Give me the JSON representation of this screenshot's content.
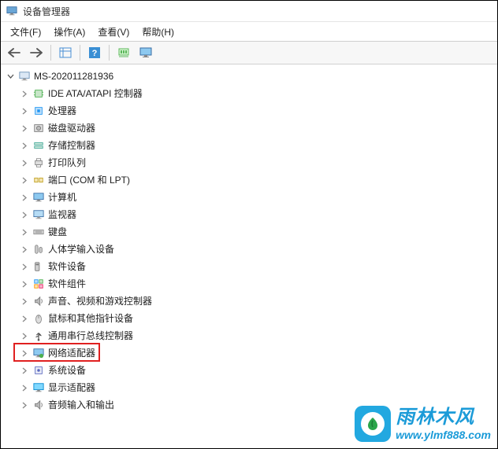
{
  "window": {
    "title": "设备管理器"
  },
  "menu": {
    "file": "文件(F)",
    "action": "操作(A)",
    "view": "查看(V)",
    "help": "帮助(H)"
  },
  "tree": {
    "root": "MS-202011281936",
    "items": [
      {
        "label": "IDE ATA/ATAPI 控制器",
        "icon": "chip",
        "highlighted": false
      },
      {
        "label": "处理器",
        "icon": "cpu",
        "highlighted": false
      },
      {
        "label": "磁盘驱动器",
        "icon": "disk",
        "highlighted": false
      },
      {
        "label": "存储控制器",
        "icon": "storage",
        "highlighted": false
      },
      {
        "label": "打印队列",
        "icon": "printer",
        "highlighted": false
      },
      {
        "label": "端口 (COM 和 LPT)",
        "icon": "port",
        "highlighted": false
      },
      {
        "label": "计算机",
        "icon": "computer",
        "highlighted": false
      },
      {
        "label": "监视器",
        "icon": "monitor",
        "highlighted": false
      },
      {
        "label": "键盘",
        "icon": "keyboard",
        "highlighted": false
      },
      {
        "label": "人体学输入设备",
        "icon": "hid",
        "highlighted": false
      },
      {
        "label": "软件设备",
        "icon": "software",
        "highlighted": false
      },
      {
        "label": "软件组件",
        "icon": "component",
        "highlighted": false
      },
      {
        "label": "声音、视频和游戏控制器",
        "icon": "audio",
        "highlighted": false
      },
      {
        "label": "鼠标和其他指针设备",
        "icon": "mouse",
        "highlighted": false
      },
      {
        "label": "通用串行总线控制器",
        "icon": "usb",
        "highlighted": false
      },
      {
        "label": "网络适配器",
        "icon": "network",
        "highlighted": true
      },
      {
        "label": "系统设备",
        "icon": "system",
        "highlighted": false
      },
      {
        "label": "显示适配器",
        "icon": "display",
        "highlighted": false
      },
      {
        "label": "音频输入和输出",
        "icon": "audio",
        "highlighted": false
      }
    ]
  },
  "watermark": {
    "cn": "雨林木风",
    "url": "www.ylmf888.com"
  },
  "colors": {
    "highlight": "#e02020",
    "brand": "#22a8e0"
  }
}
